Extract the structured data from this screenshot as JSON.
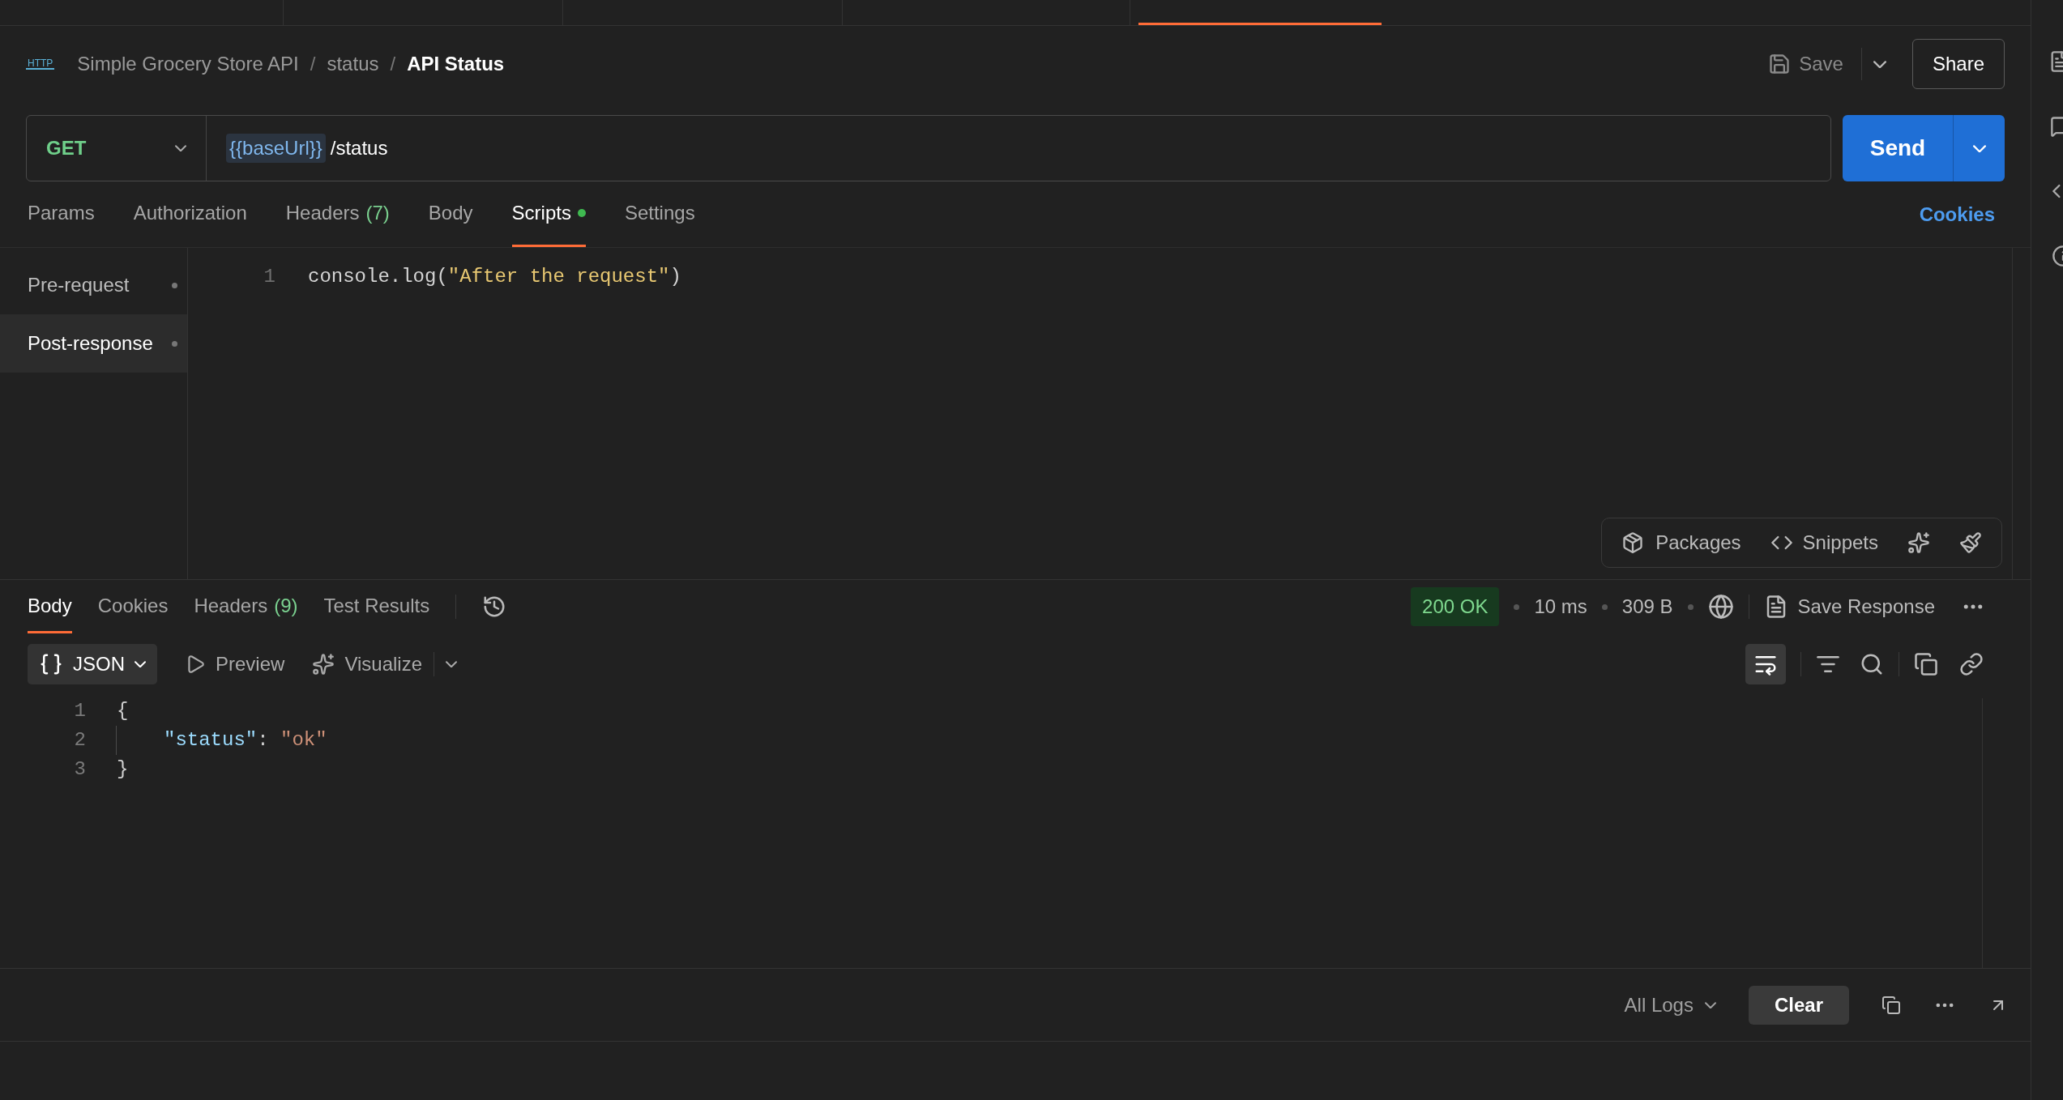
{
  "breadcrumb": {
    "icon_label": "HTTP",
    "separator": "/",
    "items": [
      {
        "label": "Simple Grocery Store API",
        "current": false
      },
      {
        "label": "status",
        "current": false
      },
      {
        "label": "API Status",
        "current": true
      }
    ]
  },
  "header_actions": {
    "save": "Save",
    "share": "Share"
  },
  "url_bar": {
    "method": "GET",
    "variable": "{{baseUrl}}",
    "path": "/status",
    "send": "Send"
  },
  "request_tabs": [
    {
      "label": "Params",
      "selected": false,
      "dot": false
    },
    {
      "label": "Authorization",
      "selected": false,
      "dot": false
    },
    {
      "label": "Headers",
      "selected": false,
      "count": "(7)",
      "dot": false
    },
    {
      "label": "Body",
      "selected": false,
      "dot": false
    },
    {
      "label": "Scripts",
      "selected": true,
      "dot": true
    },
    {
      "label": "Settings",
      "selected": false,
      "dot": false
    }
  ],
  "cookies_link": "Cookies",
  "script_sections": [
    {
      "label": "Pre-request",
      "selected": false
    },
    {
      "label": "Post-response",
      "selected": true
    }
  ],
  "script_editor": {
    "lines": [
      {
        "number": "1",
        "tokens": [
          {
            "kind": "plain",
            "text": "console.log("
          },
          {
            "kind": "string",
            "text": "\"After the request\""
          },
          {
            "kind": "plain",
            "text": ")"
          }
        ]
      }
    ]
  },
  "editor_toolbar": {
    "packages": "Packages",
    "snippets": "Snippets"
  },
  "response_tabs": [
    {
      "label": "Body",
      "selected": true
    },
    {
      "label": "Cookies",
      "selected": false
    },
    {
      "label": "Headers",
      "selected": false,
      "count": "(9)"
    },
    {
      "label": "Test Results",
      "selected": false
    }
  ],
  "response_meta": {
    "status": "200 OK",
    "time": "10 ms",
    "size": "309 B",
    "save_response": "Save Response"
  },
  "response_format": {
    "format": "JSON",
    "preview": "Preview",
    "visualize": "Visualize",
    "wrap_on": true
  },
  "response_body": {
    "lines": [
      {
        "number": "1",
        "indent_guide": false,
        "tokens": [
          {
            "kind": "punct",
            "text": "{"
          }
        ]
      },
      {
        "number": "2",
        "indent_guide": true,
        "tokens": [
          {
            "kind": "key",
            "text": "\"status\""
          },
          {
            "kind": "punct",
            "text": ": "
          },
          {
            "kind": "value",
            "text": "\"ok\""
          }
        ]
      },
      {
        "number": "3",
        "indent_guide": false,
        "tokens": [
          {
            "kind": "punct",
            "text": "}"
          }
        ]
      }
    ]
  },
  "console": {
    "filter": "All Logs",
    "clear": "Clear"
  }
}
